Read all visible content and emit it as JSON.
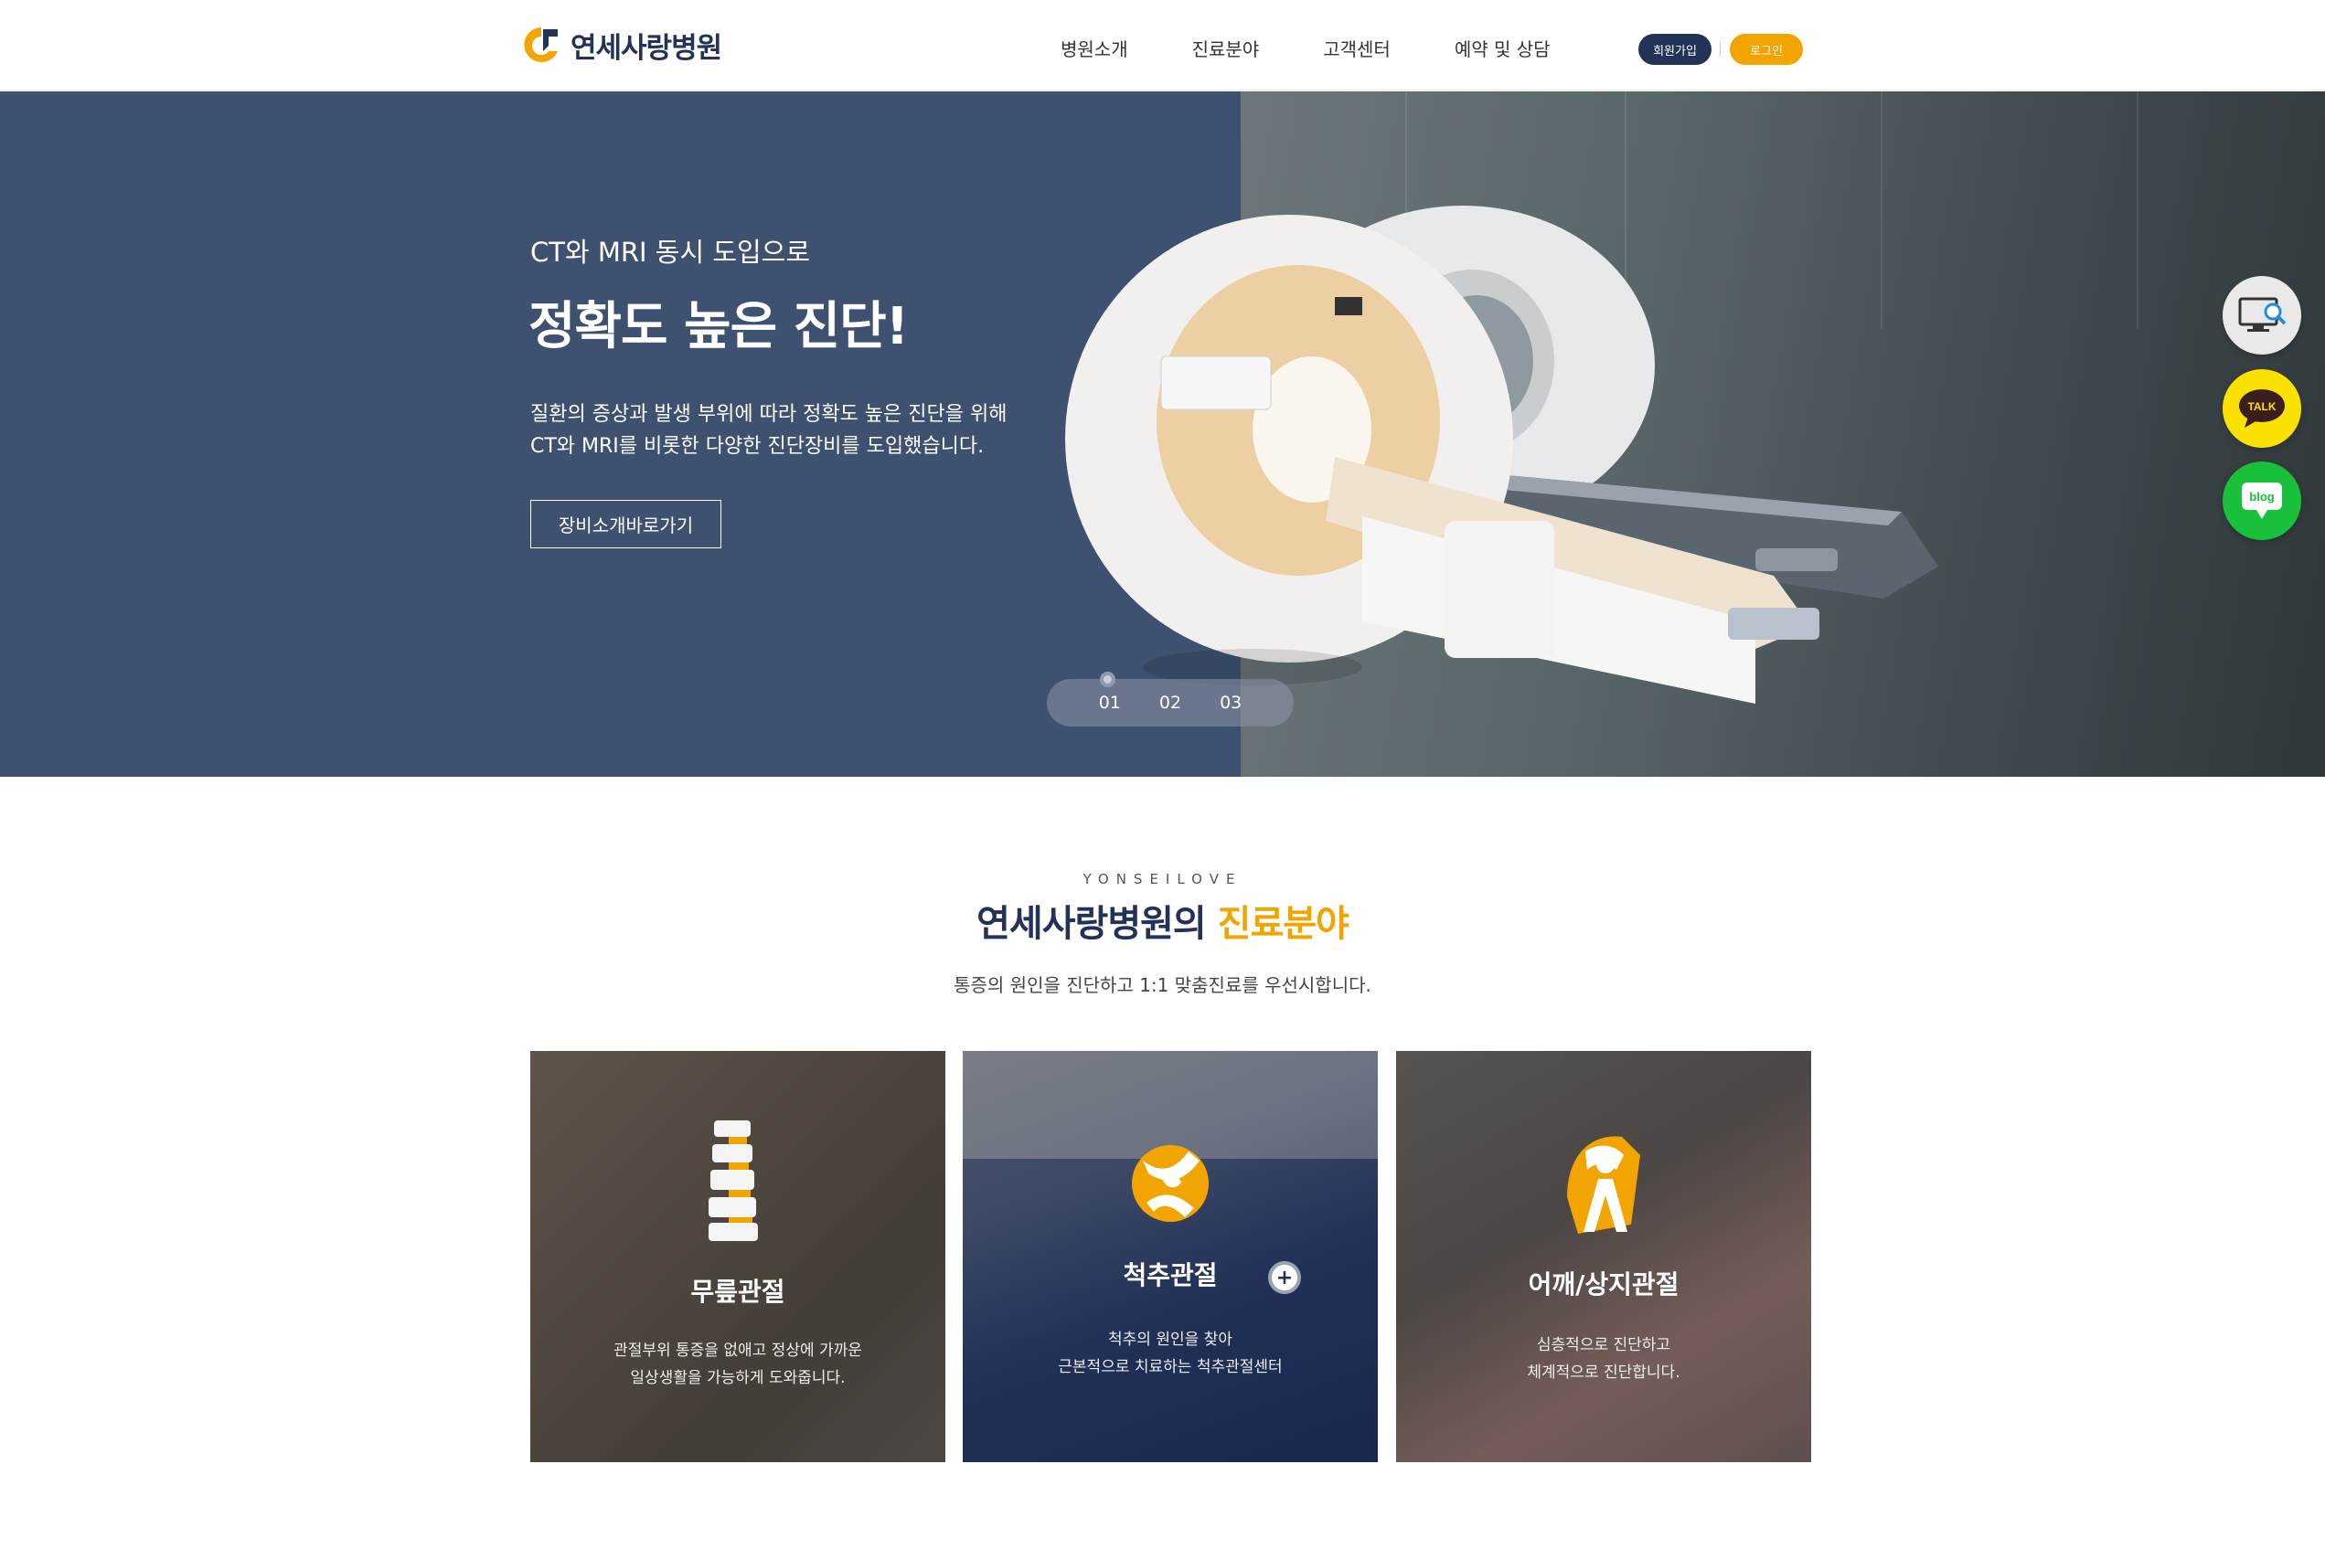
{
  "header": {
    "logo_text": "연세사랑병원",
    "nav": [
      "병원소개",
      "진료분야",
      "고객센터",
      "예약 및 상담"
    ],
    "join_label": "회원가입",
    "login_label": "로그인"
  },
  "hero": {
    "subtitle": "CT와 MRI 동시 도입으로",
    "title": "정확도 높은 진단!",
    "desc_line1": "질환의 증상과 발생 부위에 따라 정확도 높은 진단을 위해",
    "desc_line2": "CT와 MRI를 비롯한 다양한 진단장비를 도입했습니다.",
    "button_label": "장비소개바로가기",
    "pager": [
      "01",
      "02",
      "03"
    ],
    "active_slide": 1
  },
  "quick_menu": {
    "talk_label": "TALK",
    "blog_label": "blog",
    "icons": [
      "monitor-search-icon",
      "kakao-talk-icon",
      "blog-icon"
    ]
  },
  "section": {
    "eyebrow": "YONSEILOVE",
    "title_main": "연세사랑병원의 ",
    "title_highlight": "진료분야",
    "desc": "통증의 원인을 진단하고 1:1 맞춤진료를 우선시합니다."
  },
  "cards": [
    {
      "title": "무릎관절",
      "desc_line1": "관절부위 통증을 없애고 정상에 가까운",
      "desc_line2": "일상생활을 가능하게 도와줍니다.",
      "icon": "spine-icon"
    },
    {
      "title": "척추관절",
      "desc_line1": "척추의 원인을 찾아",
      "desc_line2": "근본적으로 치료하는 척추관절센터",
      "icon": "joint-icon"
    },
    {
      "title": "어깨/상지관절",
      "desc_line1": "심층적으로 진단하고",
      "desc_line2": "체계적으로 진단합니다.",
      "icon": "shoulder-icon"
    }
  ],
  "colors": {
    "navy": "#233358",
    "accent": "#f2a500",
    "hero_bg": "#3e5170"
  }
}
